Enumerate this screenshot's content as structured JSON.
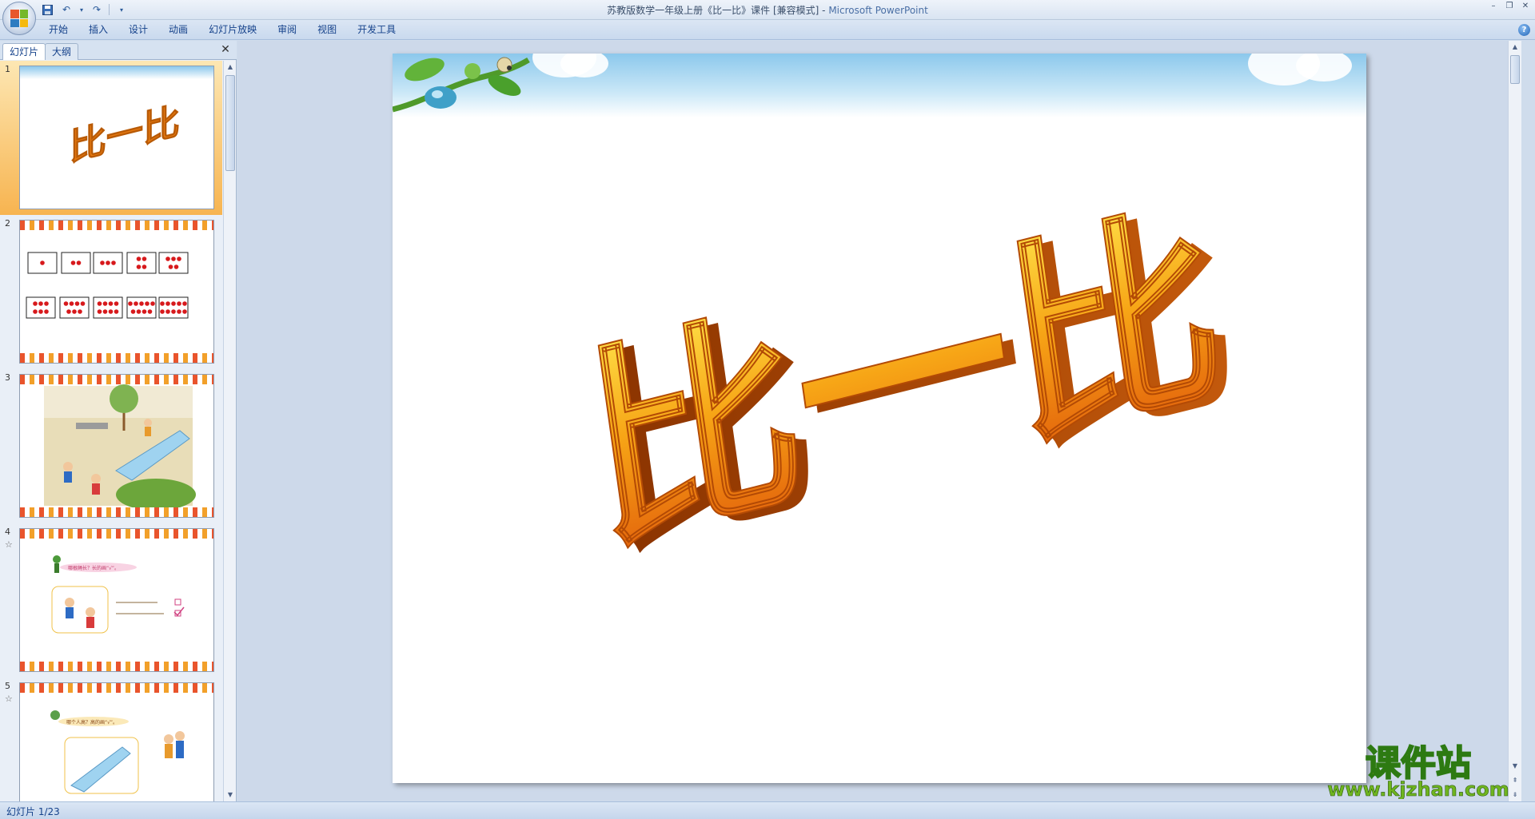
{
  "window": {
    "title": "苏教版数学一年级上册《比一比》课件 [兼容模式] - ",
    "app_name": "Microsoft PowerPoint"
  },
  "ribbon": {
    "tabs": [
      "开始",
      "插入",
      "设计",
      "动画",
      "幻灯片放映",
      "审阅",
      "视图",
      "开发工具"
    ]
  },
  "panel": {
    "tab_slides": "幻灯片",
    "tab_outline": "大纲",
    "slides": [
      {
        "number": "1",
        "star": ""
      },
      {
        "number": "2",
        "star": ""
      },
      {
        "number": "3",
        "star": ""
      },
      {
        "number": "4",
        "star": "☆"
      },
      {
        "number": "5",
        "star": "☆"
      }
    ]
  },
  "slide": {
    "title_text": "比一比"
  },
  "thumb4": {
    "caption": "哪根绳长？长的画“√”。"
  },
  "thumb5": {
    "caption": "哪个人高？高的画“√”。"
  },
  "status": {
    "text": "幻灯片 1/23"
  },
  "watermark": {
    "name": "课件站",
    "url": "www.kjzhan.com"
  },
  "colors": {
    "selected_thumb": "#f7b450",
    "title_orange": "#f08a12",
    "title_yellow": "#ffd21f",
    "watermark_green": "#6fb51f"
  }
}
